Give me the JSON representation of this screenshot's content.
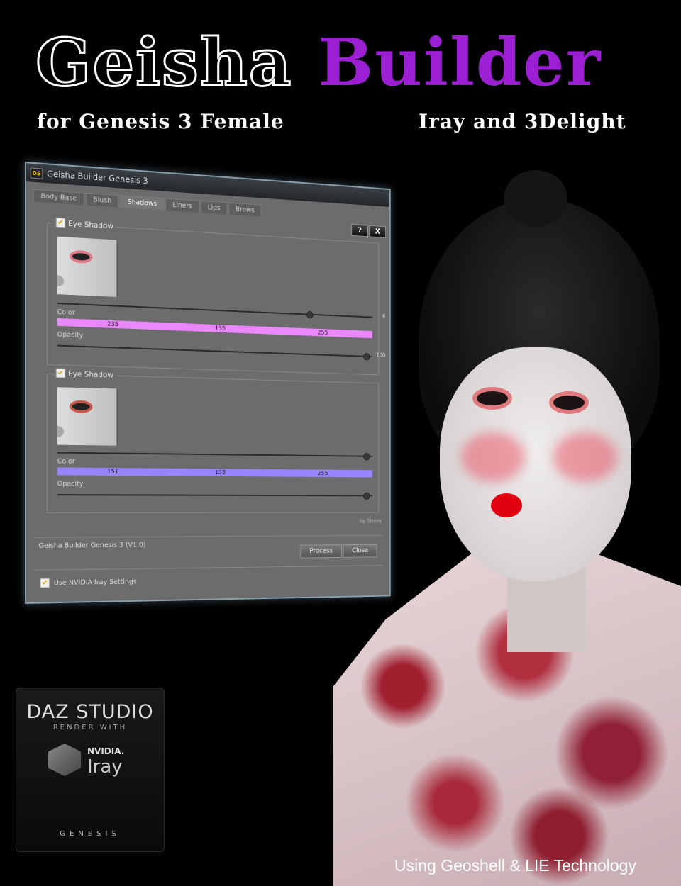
{
  "header": {
    "title_part1": "Geisha",
    "title_part2": "Builder",
    "subtitle_left": "for Genesis 3 Female",
    "subtitle_right": "Iray and 3Delight",
    "accent_color": "#9d1fd3"
  },
  "dialog": {
    "window_title": "Geisha Builder Genesis 3",
    "help_label": "?",
    "close_label": "X",
    "tabs": [
      {
        "label": "Body Base"
      },
      {
        "label": "Blush"
      },
      {
        "label": "Shadows"
      },
      {
        "label": "Liners"
      },
      {
        "label": "Lips"
      },
      {
        "label": "Brows"
      }
    ],
    "active_tab": "Shadows",
    "group1": {
      "label": "Eye Shadow",
      "checked": true,
      "slider_value": "4",
      "slider_level": 0.82,
      "color_label": "Color",
      "color_values": [
        "235",
        "135",
        "255"
      ],
      "color_hex": "#eb87ff",
      "opacity_label": "Opacity",
      "opacity_value": "100"
    },
    "group2": {
      "label": "Eye Shadow",
      "checked": true,
      "color_label": "Color",
      "color_values": [
        "151",
        "133",
        "255"
      ],
      "color_hex": "#9785ff",
      "opacity_label": "Opacity"
    },
    "credit": "by Storm",
    "version": "Geisha Builder Genesis 3 (V1.0)",
    "process_button": "Process",
    "close_button": "Close",
    "iray_setting": "Use NVIDIA Iray Settings"
  },
  "badge": {
    "daz": "DAZ STUDIO",
    "render_with": "RENDER WITH",
    "nvidia": "NVIDIA.",
    "iray": "Iray",
    "genesis": "GENESIS"
  },
  "footer": {
    "tagline": "Using Geoshell & LIE Technology"
  }
}
